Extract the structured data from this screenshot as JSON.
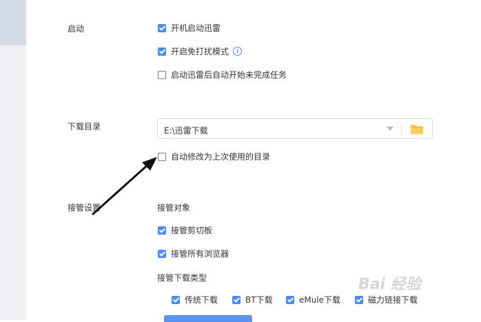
{
  "startup": {
    "label": "启动",
    "options": [
      {
        "label": "开机启动迅雷",
        "checked": true
      },
      {
        "label": "开启免打扰模式",
        "checked": true
      },
      {
        "label": "启动迅雷后自动开始未完成任务",
        "checked": false
      }
    ]
  },
  "download_dir": {
    "label": "下载目录",
    "value": "E:\\迅雷下载",
    "auto_option": {
      "label": "自动修改为上次使用的目录",
      "checked": false
    }
  },
  "takeover": {
    "label": "接管设置",
    "object_label": "接管对象",
    "objects": [
      {
        "label": "接管剪切板",
        "checked": true
      },
      {
        "label": "接管所有浏览器",
        "checked": true
      }
    ],
    "type_label": "接管下载类型",
    "types": [
      {
        "label": "传统下载",
        "checked": true
      },
      {
        "label": "BT下载",
        "checked": true
      },
      {
        "label": "eMule下载",
        "checked": true
      },
      {
        "label": "磁力链接下载",
        "checked": true
      }
    ]
  },
  "watermark": "Bai 经验",
  "icons": {
    "info": "info-icon",
    "dropdown": "chevron-down-icon",
    "folder": "folder-icon"
  },
  "colors": {
    "accent": "#4a8cf7",
    "folder": "#f5b93c",
    "arrow": "#111111"
  }
}
